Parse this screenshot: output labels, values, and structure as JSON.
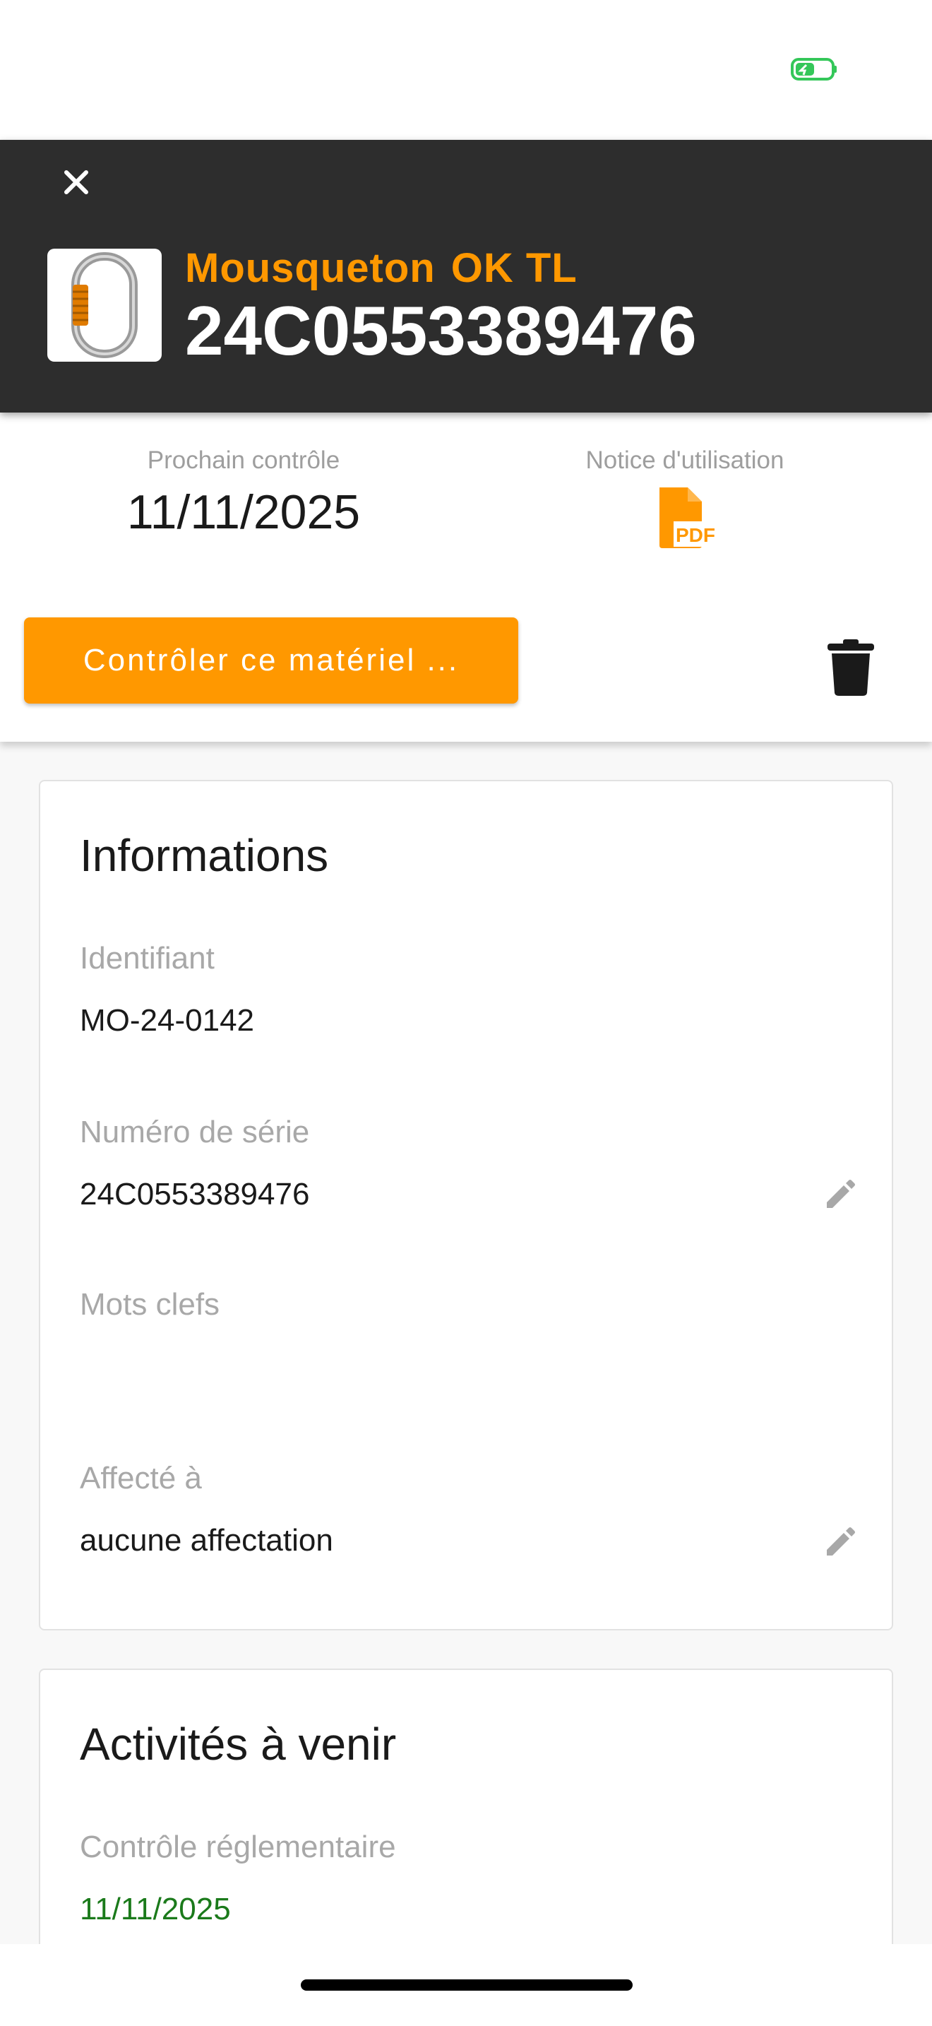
{
  "header": {
    "product_name": "Mousqueton",
    "product_model": "OK TL",
    "serial": "24C0553389476"
  },
  "summary": {
    "next_control_label": "Prochain contrôle",
    "next_control_date": "11/11/2025",
    "manual_label": "Notice d'utilisation",
    "manual_icon_text": "PDF"
  },
  "actions": {
    "control_button_label": "Contrôler ce matériel ..."
  },
  "info_card": {
    "title": "Informations",
    "fields": [
      {
        "label": "Identifiant",
        "value": "MO-24-0142"
      },
      {
        "label": "Numéro de série",
        "value": "24C0553389476"
      },
      {
        "label": "Mots clefs",
        "value": ""
      },
      {
        "label": "Affecté à",
        "value": "aucune affectation"
      }
    ]
  },
  "activities_card": {
    "title": "Activités à venir",
    "fields": [
      {
        "label": "Contrôle réglementaire",
        "value": "11/11/2025"
      }
    ]
  },
  "colors": {
    "accent": "#ff9800",
    "header_bg": "#2d2d2d",
    "status_ok": "#1b7a1b",
    "battery": "#34c759"
  },
  "icons": {
    "close": "close-icon",
    "trash": "trash-icon",
    "edit": "pencil-icon",
    "pdf": "pdf-file-icon",
    "status": "battery-icon"
  }
}
